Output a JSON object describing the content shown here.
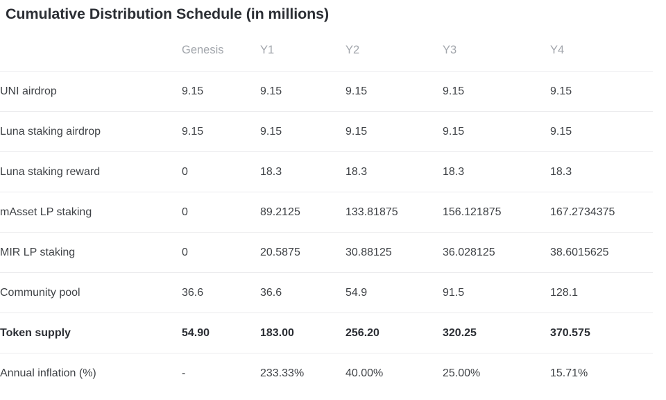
{
  "title": "Cumulative Distribution Schedule (in millions)",
  "table": {
    "row_header_label": "",
    "columns": [
      "Genesis",
      "Y1",
      "Y2",
      "Y3",
      "Y4"
    ],
    "rows": [
      {
        "label": "UNI airdrop",
        "emphasis": "normal",
        "values": [
          "9.15",
          "9.15",
          "9.15",
          "9.15",
          "9.15"
        ]
      },
      {
        "label": "Luna staking airdrop",
        "emphasis": "normal",
        "values": [
          "9.15",
          "9.15",
          "9.15",
          "9.15",
          "9.15"
        ]
      },
      {
        "label": "Luna staking reward",
        "emphasis": "normal",
        "values": [
          "0",
          "18.3",
          "18.3",
          "18.3",
          "18.3"
        ]
      },
      {
        "label": "mAsset LP staking",
        "emphasis": "normal",
        "values": [
          "0",
          "89.2125",
          "133.81875",
          "156.121875",
          "167.2734375"
        ]
      },
      {
        "label": "MIR LP staking",
        "emphasis": "normal",
        "values": [
          "0",
          "20.5875",
          "30.88125",
          "36.028125",
          "38.6015625"
        ]
      },
      {
        "label": "Community pool",
        "emphasis": "normal",
        "values": [
          "36.6",
          "36.6",
          "54.9",
          "91.5",
          "128.1"
        ]
      },
      {
        "label": "Token supply",
        "emphasis": "bold",
        "values": [
          "54.90",
          "183.00",
          "256.20",
          "320.25",
          "370.575"
        ]
      },
      {
        "label": "Annual inflation (%)",
        "emphasis": "normal",
        "values": [
          "-",
          "233.33%",
          "40.00%",
          "25.00%",
          "15.71%"
        ]
      }
    ]
  },
  "chart_data": {
    "type": "table",
    "title": "Cumulative Distribution Schedule (in millions)",
    "categories": [
      "Genesis",
      "Y1",
      "Y2",
      "Y3",
      "Y4"
    ],
    "xlabel": "",
    "ylabel": "",
    "series": [
      {
        "name": "UNI airdrop",
        "values": [
          9.15,
          9.15,
          9.15,
          9.15,
          9.15
        ]
      },
      {
        "name": "Luna staking airdrop",
        "values": [
          9.15,
          9.15,
          9.15,
          9.15,
          9.15
        ]
      },
      {
        "name": "Luna staking reward",
        "values": [
          0,
          18.3,
          18.3,
          18.3,
          18.3
        ]
      },
      {
        "name": "mAsset LP staking",
        "values": [
          0,
          89.2125,
          133.81875,
          156.121875,
          167.2734375
        ]
      },
      {
        "name": "MIR LP staking",
        "values": [
          0,
          20.5875,
          30.88125,
          36.028125,
          38.6015625
        ]
      },
      {
        "name": "Community pool",
        "values": [
          36.6,
          36.6,
          54.9,
          91.5,
          128.1
        ]
      },
      {
        "name": "Token supply",
        "values": [
          54.9,
          183.0,
          256.2,
          320.25,
          370.575
        ]
      },
      {
        "name": "Annual inflation (%)",
        "values": [
          null,
          233.33,
          40.0,
          25.0,
          15.71
        ]
      }
    ]
  },
  "colors": {
    "background": "#ffffff",
    "title_text": "#2b2e34",
    "header_text": "#a2a6ac",
    "body_text": "#3f4246",
    "total_text": "#2b2e34",
    "divider": "#ececee"
  }
}
